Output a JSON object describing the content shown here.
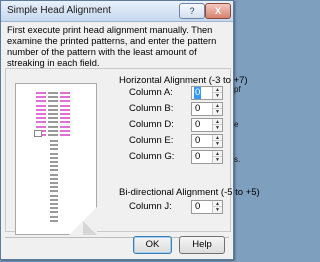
{
  "dialog": {
    "title": "Simple Head Alignment",
    "instructions": "First execute print head alignment manually. Then examine the printed patterns, and enter the pattern number of the pattern with the least amount of streaking in each field."
  },
  "horizontal": {
    "heading": "Horizontal Alignment (-3 to +7)",
    "fields": [
      {
        "label": "Column A:",
        "value": "0",
        "selected": true
      },
      {
        "label": "Column B:",
        "value": "0",
        "selected": false
      },
      {
        "label": "Column D:",
        "value": "0",
        "selected": false
      },
      {
        "label": "Column E:",
        "value": "0",
        "selected": false
      },
      {
        "label": "Column G:",
        "value": "0",
        "selected": false
      }
    ]
  },
  "bidirectional": {
    "heading": "Bi-directional Alignment (-5 to +5)",
    "fields": [
      {
        "label": "Column J:",
        "value": "0",
        "selected": false
      }
    ]
  },
  "buttons": {
    "ok": "OK",
    "help": "Help",
    "title_help": "?",
    "title_close": "X"
  },
  "colors": {
    "pattern_magenta": "#e070d8",
    "pattern_gray": "#9a9a9a",
    "selection": "#3399ff"
  },
  "background_window_fragments": [
    "pf",
    "e",
    "s."
  ]
}
